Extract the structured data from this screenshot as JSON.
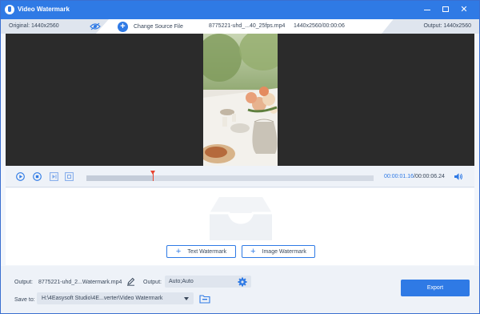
{
  "window": {
    "title": "Video Watermark",
    "minimize_symbol": "",
    "close_symbol": "✕"
  },
  "infobar": {
    "original_label": "Original: 1440x2560",
    "change_source_label": "Change Source File",
    "file_name": "8775221-uhd_...40_25fps.mp4",
    "file_meta": "1440x2560/00:00:06",
    "output_label": "Output: 1440x2560"
  },
  "player": {
    "current_time": "00:00:01.16",
    "separator": "/",
    "total_time": "00:00:06.24",
    "progress_fraction": 0.23
  },
  "watermark": {
    "text_button": "Text Watermark",
    "image_button": "Image Watermark",
    "plus_symbol": "+"
  },
  "bottom": {
    "output_label": "Output:",
    "output_file": "8775221-uhd_2...Watermark.mp4",
    "format_label": "Output:",
    "format_value": "Auto;Auto",
    "save_to_label": "Save to:",
    "save_path": "H:\\4Easysoft Studio\\4E...verter\\Video Watermark",
    "export_label": "Export"
  },
  "colors": {
    "accent": "#2f7ae5",
    "titlebar": "#2f7ae5",
    "preview_bg": "#2b2b2b",
    "playhead": "#e8432f"
  },
  "icons": [
    "app-logo-icon",
    "eye-icon",
    "add-circle-icon",
    "play-icon",
    "stop-icon",
    "next-frame-icon",
    "snapshot-icon",
    "volume-icon",
    "tray-icon",
    "edit-icon",
    "gear-icon",
    "folder-icon",
    "chevron-down-icon"
  ]
}
